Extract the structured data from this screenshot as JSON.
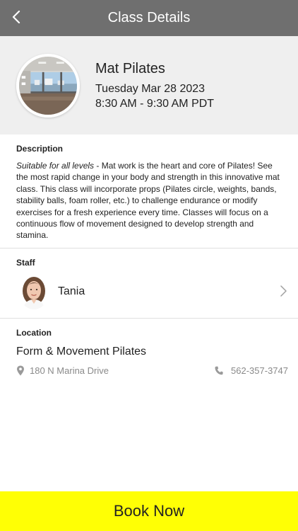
{
  "nav": {
    "title": "Class Details",
    "back_icon": "chevron-left-icon"
  },
  "class": {
    "name": "Mat Pilates",
    "date": "Tuesday Mar 28 2023",
    "time": "8:30 AM - 9:30 AM PDT",
    "photo": "studio-photo"
  },
  "description": {
    "label": "Description",
    "lead": "Suitable for all levels",
    "body": " - Mat work is the heart and core of Pilates! See the most rapid change in your body and strength in this innovative mat class. This class will incorporate props (Pilates circle, weights, bands, stability balls, foam roller, etc.) to challenge endurance or modify exercises for a fresh experience every time. Classes will focus on a continuous flow of movement designed to develop strength and stamina."
  },
  "staff": {
    "label": "Staff",
    "name": "Tania",
    "chevron_icon": "chevron-right-icon"
  },
  "location": {
    "label": "Location",
    "name": "Form & Movement Pilates",
    "address": "180 N Marina Drive",
    "phone": "562-357-3747",
    "address_icon": "map-pin-icon",
    "phone_icon": "phone-icon"
  },
  "action": {
    "book_label": "Book Now"
  },
  "colors": {
    "nav_bar": "#6f6f6f",
    "hero_bg": "#efefef",
    "book_button": "#ffff05",
    "secondary_text": "#8a8a8a"
  }
}
